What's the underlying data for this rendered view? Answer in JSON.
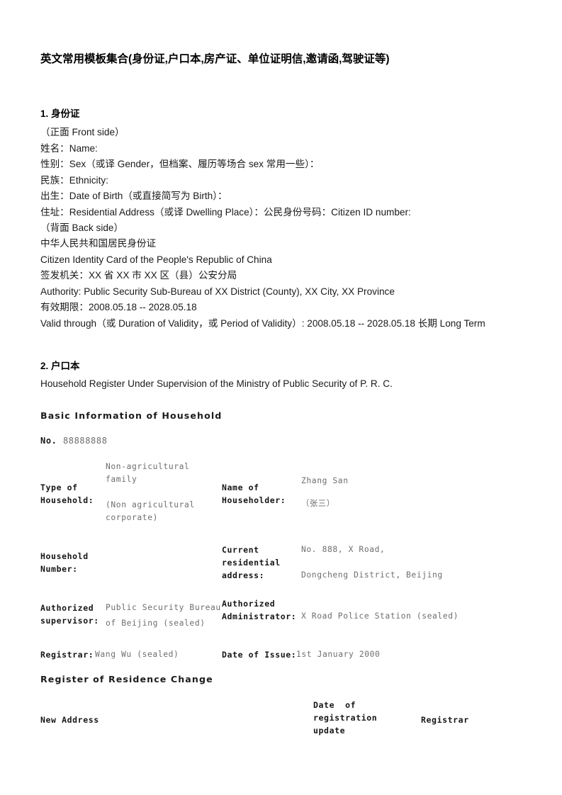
{
  "document": {
    "title": "英文常用模板集合(身份证,户口本,房产证、单位证明信,邀请函,驾驶证等)"
  },
  "section1": {
    "heading": "1. 身份证",
    "lines": [
      "（正面 Front side）",
      "姓名：Name:",
      "性别：Sex（或译 Gender，但档案、履历等场合 sex 常用一些）：",
      "民族：Ethnicity:",
      "出生：Date of Birth（或直接简写为 Birth）：",
      "住址：Residential Address（或译 Dwelling Place）：公民身份号码：Citizen ID number:",
      "（背面 Back side）",
      "中华人民共和国居民身份证",
      "Citizen Identity Card of the People's Republic of China",
      "签发机关：XX 省 XX 市 XX 区（县）公安分局",
      "Authority: Public Security Sub-Bureau of XX District (County), XX City, XX Province",
      "有效期限：2008.05.18 -- 2028.05.18"
    ],
    "wrapped_line": "Valid through（或 Duration of Validity，或 Period of Validity）: 2008.05.18 -- 2028.05.18 长期 Long Term"
  },
  "section2": {
    "heading": "2. 户口本",
    "subtitle": "Household Register Under Supervision of the Ministry of Public Security of P. R. C.",
    "basic_info_heading": "Basic Information of Household",
    "no_label": "No.",
    "no_value": "88888888",
    "register_change_heading": "Register of Residence Change",
    "table": {
      "row1": {
        "label_left": "Type of\nHousehold:",
        "value_left_top": "Non-agricultural\nfamily",
        "value_left_bottom": "(Non agricultural\ncorporate)",
        "label_right": "Name of\nHouseholder:",
        "value_right_top": "Zhang  San",
        "value_right_bottom": "（张三）"
      },
      "row2": {
        "label_left": "Household\nNumber:",
        "value_left": "",
        "label_right": "Current\nresidential\naddress:",
        "value_right_top": "No.  888,  X  Road,",
        "value_right_bottom": "Dongcheng  District,  Beijing"
      },
      "row3": {
        "label_left": "Authorized\nsupervisor:",
        "value_left_top": "Public  Security  Bureau",
        "value_left_bottom": "of  Beijing  (sealed)",
        "label_right": "Authorized\nAdministrator:",
        "value_right": "X  Road  Police  Station  (sealed)"
      },
      "row4": {
        "label_left": "Registrar:",
        "value_left": "Wang  Wu  (sealed)",
        "label_right": "Date  of  Issue:",
        "value_right": "1st  January  2000"
      },
      "change_headers": {
        "new_address": "New  Address",
        "date_of_registration_update": "Date  of\nregistration\nupdate",
        "registrar": "Registrar"
      }
    }
  }
}
